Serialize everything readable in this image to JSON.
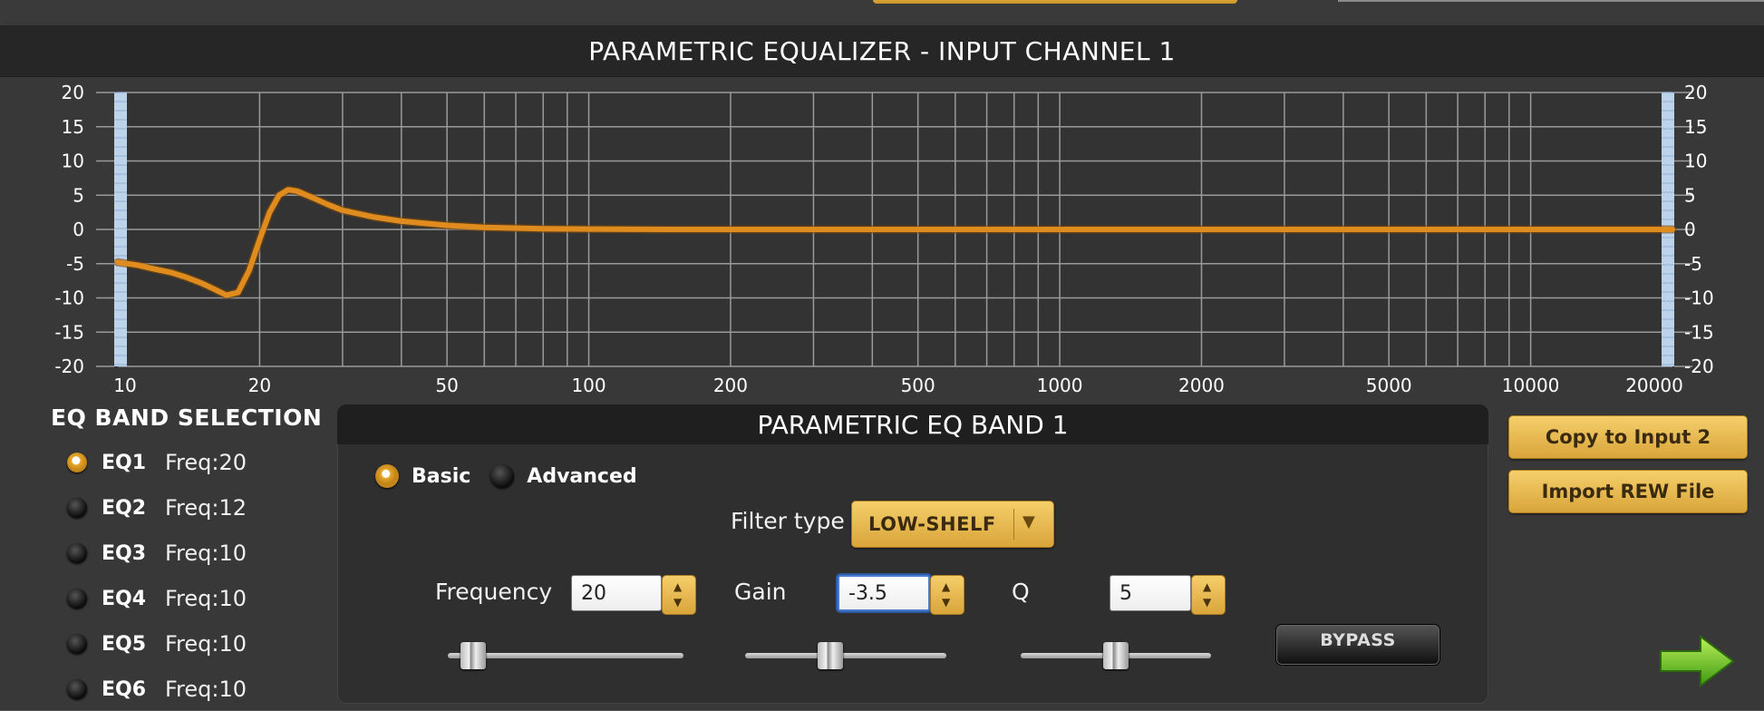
{
  "window": {
    "title": "PARAMETRIC EQUALIZER - INPUT CHANNEL 1"
  },
  "chart_data": {
    "type": "line",
    "title": "",
    "xscale": "log",
    "xlim": [
      10,
      20000
    ],
    "ylim": [
      -20,
      20
    ],
    "x_tick_labels": [
      "10",
      "20",
      "50",
      "100",
      "200",
      "500",
      "1000",
      "2000",
      "5000",
      "10000",
      "20000"
    ],
    "x_ticks": [
      10,
      20,
      50,
      100,
      200,
      500,
      1000,
      2000,
      5000,
      10000,
      20000
    ],
    "y_ticks": [
      20,
      15,
      10,
      5,
      0,
      -5,
      -10,
      -15,
      -20
    ],
    "y_tick_labels": [
      "20",
      "15",
      "10",
      "5",
      "0",
      "-5",
      "-10",
      "-15",
      "-20"
    ],
    "grid": true,
    "series": [
      {
        "x": [
          10,
          11,
          12,
          13,
          14,
          15,
          16,
          17,
          18,
          19,
          20,
          21,
          22,
          23,
          24,
          26,
          28,
          30,
          35,
          40,
          50,
          60,
          80,
          100,
          150,
          200,
          500,
          1000,
          2000,
          5000,
          10000,
          20000
        ],
        "values": [
          -4.8,
          -5.2,
          -5.8,
          -6.3,
          -7.0,
          -7.8,
          -8.7,
          -9.6,
          -9.2,
          -6.0,
          -1.5,
          2.5,
          5.0,
          5.8,
          5.6,
          4.6,
          3.6,
          2.8,
          1.8,
          1.2,
          0.6,
          0.3,
          0.1,
          0.05,
          0,
          0,
          0,
          0,
          0,
          0,
          0,
          0
        ]
      }
    ],
    "colors": {
      "curve": "#e08b1e",
      "grid": "#9a9a9a",
      "axis_band": "#bcd3ea"
    }
  },
  "band_selection": {
    "title": "EQ BAND SELECTION",
    "bands": [
      {
        "name": "EQ1",
        "freq": "Freq:20",
        "selected": true
      },
      {
        "name": "EQ2",
        "freq": "Freq:12",
        "selected": false
      },
      {
        "name": "EQ3",
        "freq": "Freq:10",
        "selected": false
      },
      {
        "name": "EQ4",
        "freq": "Freq:10",
        "selected": false
      },
      {
        "name": "EQ5",
        "freq": "Freq:10",
        "selected": false
      },
      {
        "name": "EQ6",
        "freq": "Freq:10",
        "selected": false
      }
    ]
  },
  "band_panel": {
    "title": "PARAMETRIC EQ BAND 1",
    "mode_basic": "Basic",
    "mode_advanced": "Advanced",
    "filter_type_label": "Filter type",
    "filter_type_value": "LOW-SHELF",
    "frequency_label": "Frequency",
    "frequency_value": "20",
    "gain_label": "Gain",
    "gain_value": "-3.5",
    "q_label": "Q",
    "q_value": "5",
    "bypass_label": "BYPASS",
    "frequency_slider_level": 0.06,
    "gain_slider_level": 0.41,
    "q_slider_level": 0.5
  },
  "actions": {
    "copy_label": "Copy to Input 2",
    "import_label": "Import REW File"
  },
  "icons": {
    "next": "arrow-right-icon",
    "radio": "radio-button-icon",
    "dropdown": "chevron-down-icon"
  },
  "colors": {
    "accent": "#e5b14a",
    "panel_bg": "#383838",
    "header_bg": "#262626",
    "curve": "#e08b1e"
  }
}
